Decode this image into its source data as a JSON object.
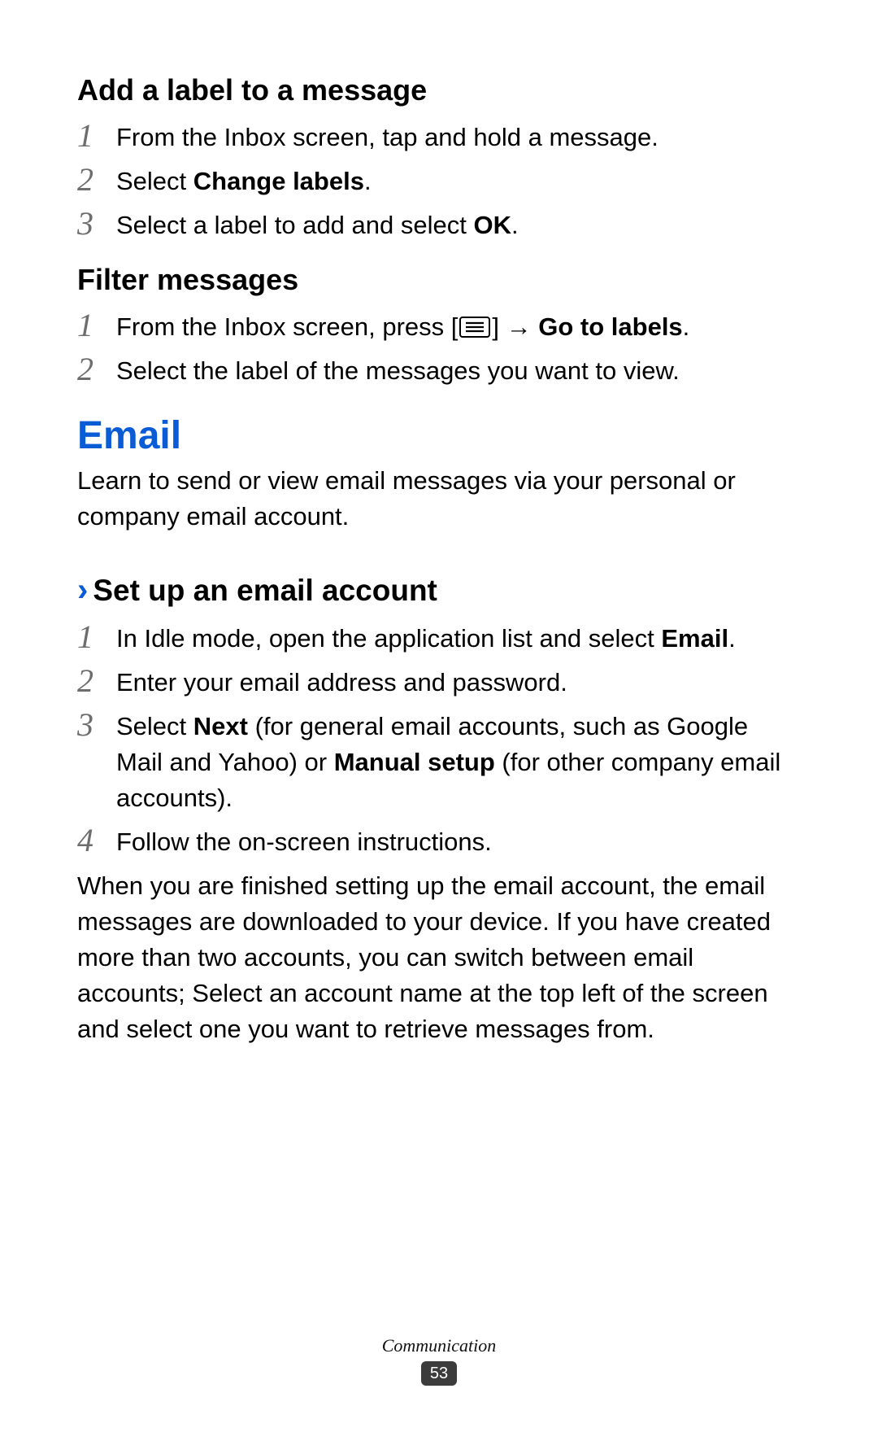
{
  "section1": {
    "heading": "Add a label to a message",
    "steps": [
      {
        "n": "1",
        "plain1": "From the Inbox screen, tap and hold a message."
      },
      {
        "n": "2",
        "plain1": "Select ",
        "bold1": "Change labels",
        "plain2": "."
      },
      {
        "n": "3",
        "plain1": "Select a label to add and select ",
        "bold1": "OK",
        "plain2": "."
      }
    ]
  },
  "section2": {
    "heading": "Filter messages",
    "steps": [
      {
        "n": "1",
        "plain1": "From the Inbox screen, press [",
        "icon": "menu",
        "plain2": "] → ",
        "bold1": "Go to labels",
        "plain3": "."
      },
      {
        "n": "2",
        "plain1": "Select the label of the messages you want to view."
      }
    ]
  },
  "email": {
    "heading": "Email",
    "intro": "Learn to send or view email messages via your personal or company email account.",
    "sub": {
      "heading": "Set up an email account",
      "steps": [
        {
          "n": "1",
          "plain1": "In Idle mode, open the application list and select ",
          "bold1": "Email",
          "plain2": "."
        },
        {
          "n": "2",
          "plain1": "Enter your email address and password."
        },
        {
          "n": "3",
          "plain1": "Select ",
          "bold1": "Next",
          "plain2": " (for general email accounts, such as Google Mail and Yahoo) or ",
          "bold2": "Manual setup",
          "plain3": " (for other company email accounts)."
        },
        {
          "n": "4",
          "plain1": "Follow the on-screen instructions."
        }
      ],
      "after": "When you are finished setting up the email account, the email messages are downloaded to your device. If you have created more than two accounts, you can switch between email accounts; Select an account name at the top left of the screen and select one you want to retrieve messages from."
    }
  },
  "footer": {
    "category": "Communication",
    "page": "53"
  }
}
